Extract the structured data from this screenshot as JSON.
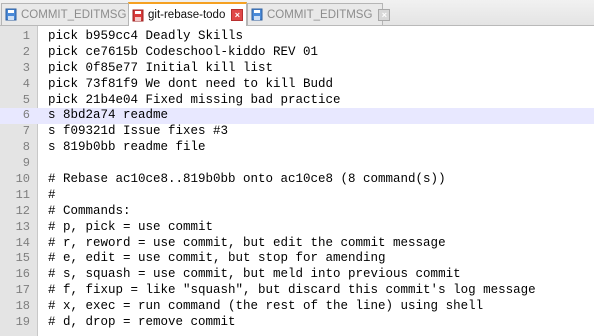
{
  "tabs": [
    {
      "label": "COMMIT_EDITMSG",
      "icon": "file-saved-icon",
      "active": false
    },
    {
      "label": "git-rebase-todo",
      "icon": "file-modified-icon",
      "active": true
    },
    {
      "label": "COMMIT_EDITMSG",
      "icon": "file-saved-icon",
      "active": false
    }
  ],
  "colors": {
    "saved_icon": "#4a8ad8",
    "modified_icon": "#d93a3a",
    "active_tab_accent": "#f5a122",
    "current_line": "#e8e8ff"
  },
  "current_line": 6,
  "lines": [
    {
      "n": "1",
      "text": "pick b959cc4 Deadly Skills"
    },
    {
      "n": "2",
      "text": "pick ce7615b Codeschool-kiddo REV 01"
    },
    {
      "n": "3",
      "text": "pick 0f85e77 Initial kill list"
    },
    {
      "n": "4",
      "text": "pick 73f81f9 We dont need to kill Budd"
    },
    {
      "n": "5",
      "text": "pick 21b4e04 Fixed missing bad practice"
    },
    {
      "n": "6",
      "text": "s 8bd2a74 readme"
    },
    {
      "n": "7",
      "text": "s f09321d Issue fixes #3"
    },
    {
      "n": "8",
      "text": "s 819b0bb readme file"
    },
    {
      "n": "9",
      "text": ""
    },
    {
      "n": "10",
      "text": "# Rebase ac10ce8..819b0bb onto ac10ce8 (8 command(s))"
    },
    {
      "n": "11",
      "text": "#"
    },
    {
      "n": "12",
      "text": "# Commands:"
    },
    {
      "n": "13",
      "text": "# p, pick = use commit"
    },
    {
      "n": "14",
      "text": "# r, reword = use commit, but edit the commit message"
    },
    {
      "n": "15",
      "text": "# e, edit = use commit, but stop for amending"
    },
    {
      "n": "16",
      "text": "# s, squash = use commit, but meld into previous commit"
    },
    {
      "n": "17",
      "text": "# f, fixup = like \"squash\", but discard this commit's log message"
    },
    {
      "n": "18",
      "text": "# x, exec = run command (the rest of the line) using shell"
    },
    {
      "n": "19",
      "text": "# d, drop = remove commit"
    }
  ]
}
